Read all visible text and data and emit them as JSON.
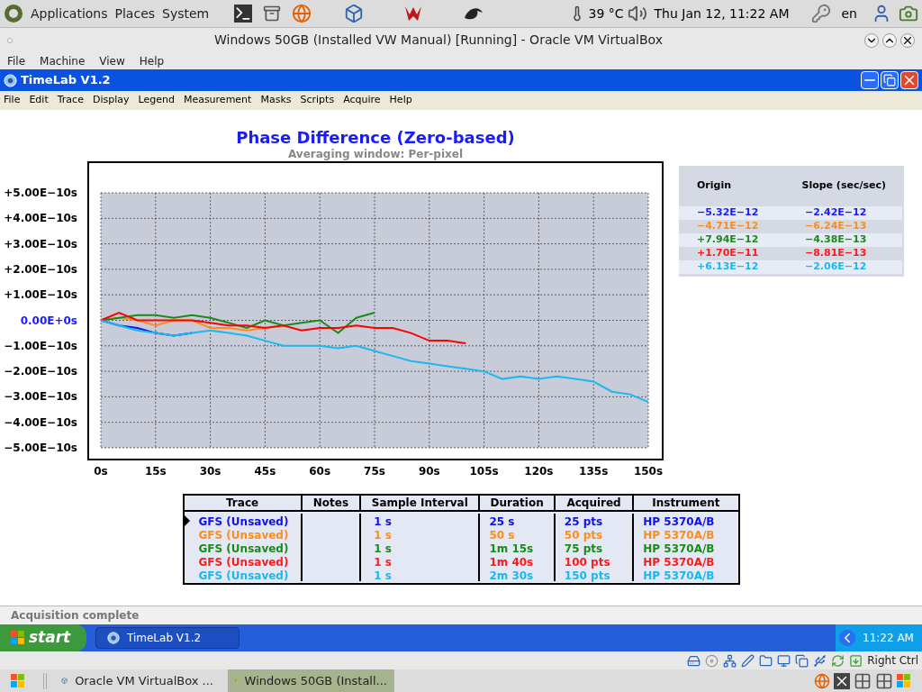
{
  "top_panel": {
    "menus": [
      "Applications",
      "Places",
      "System"
    ],
    "temperature": "39 °C",
    "clock": "Thu Jan 12, 11:22 AM",
    "keyboard_layout": "en"
  },
  "vbox_window": {
    "title": "Windows 50GB (Installed VW Manual) [Running] - Oracle VM VirtualBox",
    "menu": [
      "File",
      "Machine",
      "View",
      "Help"
    ]
  },
  "app_window": {
    "title": "TimeLab V1.2",
    "menu": [
      "File",
      "Edit",
      "Trace",
      "Display",
      "Legend",
      "Measurement",
      "Masks",
      "Scripts",
      "Acquire",
      "Help"
    ]
  },
  "plot": {
    "title": "Phase Difference (Zero-based)",
    "subtitle": "Averaging window: Per-pixel",
    "y_axis_labels": [
      {
        "label": "+5.00E−10s",
        "kind": "plain"
      },
      {
        "label": "+4.00E−10s",
        "kind": "plain"
      },
      {
        "label": "+3.00E−10s",
        "kind": "plain"
      },
      {
        "label": "+2.00E−10s",
        "kind": "plain"
      },
      {
        "label": "+1.00E−10s",
        "kind": "plain"
      },
      {
        "label": "0.00E+0s",
        "kind": "zero"
      },
      {
        "label": "−1.00E−10s",
        "kind": "plain"
      },
      {
        "label": "−2.00E−10s",
        "kind": "plain"
      },
      {
        "label": "−3.00E−10s",
        "kind": "plain"
      },
      {
        "label": "−4.00E−10s",
        "kind": "plain"
      },
      {
        "label": "−5.00E−10s",
        "kind": "plain"
      }
    ],
    "x_axis_labels": [
      "0s",
      "15s",
      "30s",
      "45s",
      "60s",
      "75s",
      "90s",
      "105s",
      "120s",
      "135s",
      "150s"
    ],
    "traces": [
      {
        "color": "#1010f0"
      },
      {
        "color": "#ff8c1a"
      },
      {
        "color": "#1a8a1a"
      },
      {
        "color": "#ff0000"
      },
      {
        "color": "#1ab8f0"
      }
    ]
  },
  "fit_table": {
    "columns": [
      "Origin",
      "Slope (sec/sec)"
    ],
    "rows": [
      {
        "origin": "−5.32E−12",
        "slope": "−2.42E−12",
        "color": "#1a1aff"
      },
      {
        "origin": "−4.71E−12",
        "slope": "−6.24E−13",
        "color": "#ff8c1a"
      },
      {
        "origin": "+7.94E−12",
        "slope": "−4.38E−13",
        "color": "#1a8a1a"
      },
      {
        "origin": "+1.70E−11",
        "slope": "−8.81E−13",
        "color": "#ff1a1a"
      },
      {
        "origin": "+6.13E−12",
        "slope": "−2.06E−12",
        "color": "#1ab8f0"
      }
    ]
  },
  "trace_table": {
    "columns": [
      "Trace",
      "Notes",
      "Sample Interval",
      "Duration",
      "Acquired",
      "Instrument"
    ],
    "rows": [
      {
        "trace": "GFS (Unsaved)",
        "sample_interval": "1 s",
        "duration": "25 s",
        "acquired": "25 pts",
        "instrument": "HP 5370A/B",
        "color": "#1010f0",
        "selected": true
      },
      {
        "trace": "GFS (Unsaved)",
        "sample_interval": "1 s",
        "duration": "50 s",
        "acquired": "50 pts",
        "instrument": "HP 5370A/B",
        "color": "#ff8c1a",
        "selected": false
      },
      {
        "trace": "GFS (Unsaved)",
        "sample_interval": "1 s",
        "duration": "1m 15s",
        "acquired": "75 pts",
        "instrument": "HP 5370A/B",
        "color": "#1a8a1a",
        "selected": false
      },
      {
        "trace": "GFS (Unsaved)",
        "sample_interval": "1 s",
        "duration": "1m 40s",
        "acquired": "100 pts",
        "instrument": "HP 5370A/B",
        "color": "#ff1a1a",
        "selected": false
      },
      {
        "trace": "GFS (Unsaved)",
        "sample_interval": "1 s",
        "duration": "2m 30s",
        "acquired": "150 pts",
        "instrument": "HP 5370A/B",
        "color": "#1ab8f0",
        "selected": false
      }
    ]
  },
  "status_bar": "Acquisition complete",
  "xp_taskbar": {
    "start": "start",
    "tasks": [
      {
        "label": "TimeLab V1.2",
        "selected": true
      }
    ],
    "clock": "11:22 AM"
  },
  "vbox_status": {
    "host_key": "Right Ctrl"
  },
  "bottom_panel": {
    "tasks": [
      {
        "label": "Oracle VM VirtualBox ...",
        "selected": false
      },
      {
        "label": "Windows 50GB (Install...",
        "selected": true
      }
    ]
  }
}
